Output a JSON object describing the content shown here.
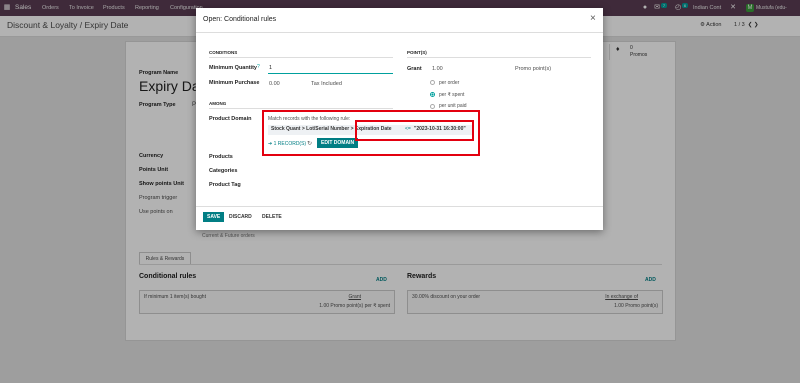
{
  "topbar": {
    "app": "Sales",
    "menus": [
      "Orders",
      "To Invoice",
      "Products",
      "Reporting",
      "Configuration"
    ],
    "chat_count": "7",
    "activity_count": "6",
    "company": "Indian Cont",
    "avatar_letter": "M",
    "user": "Mustufa (edu-mustufarah)"
  },
  "breadcrumb": "Discount & Loyalty / Expiry Date",
  "actions": {
    "action_label": "Action",
    "pager": "1 / 3"
  },
  "background_form": {
    "program_name_label": "Program Name",
    "program_name": "Expiry Da",
    "program_type_label": "Program Type",
    "program_type_short": "P",
    "currency_label": "Currency",
    "points_unit_label": "Points Unit",
    "show_points_unit_label": "Show points Unit",
    "program_trigger_label": "Program trigger",
    "use_points_on_label": "Use points on",
    "use_points_on_value": "Current & Future orders",
    "promos_count": "0",
    "promos_label": "Promos",
    "tab": "Rules & Rewards",
    "rules_title": "Conditional rules",
    "rules_add": "ADD",
    "rule_line": "If minimum 1 item(s) bought",
    "rule_grant_head": "Grant",
    "rule_grant": "1.00 Promo point(s) per ₹ spent",
    "rewards_title": "Rewards",
    "rewards_add": "ADD",
    "reward_line": "30.00% discount on your order",
    "reward_exchange_head": "In exchange of",
    "reward_exchange": "1.00 Promo point(s)"
  },
  "modal": {
    "title": "Open: Conditional rules",
    "close": "×",
    "conditions_head": "CONDITIONS",
    "min_qty_label": "Minimum Quantity",
    "min_qty_value": "1",
    "min_purchase_label": "Minimum Purchase",
    "min_purchase_value": "0.00",
    "tax_label": "Tax Included",
    "among_head": "AMONG",
    "product_domain_label": "Product Domain",
    "domain_text": "Match records with the following rule:",
    "domain_path": "Stock Quant > Lot/Serial Number > Expiration Date",
    "domain_operator": "<=",
    "domain_value": "\"2023-10-31 16:30:00\"",
    "records": "1 RECORD(S)",
    "edit_domain": "EDIT DOMAIN",
    "products_label": "Products",
    "categories_label": "Categories",
    "product_tag_label": "Product Tag",
    "points_head": "POINT(S)",
    "grant_label": "Grant",
    "grant_value": "1.00",
    "grant_unit": "Promo point(s)",
    "options": [
      "per order",
      "per ₹ spent",
      "per unit paid"
    ],
    "save": "SAVE",
    "discard": "DISCARD",
    "delete": "DELETE"
  },
  "colors": {
    "brand": "#5b3d53",
    "accent": "#017e84",
    "highlight": "#e3000f"
  }
}
